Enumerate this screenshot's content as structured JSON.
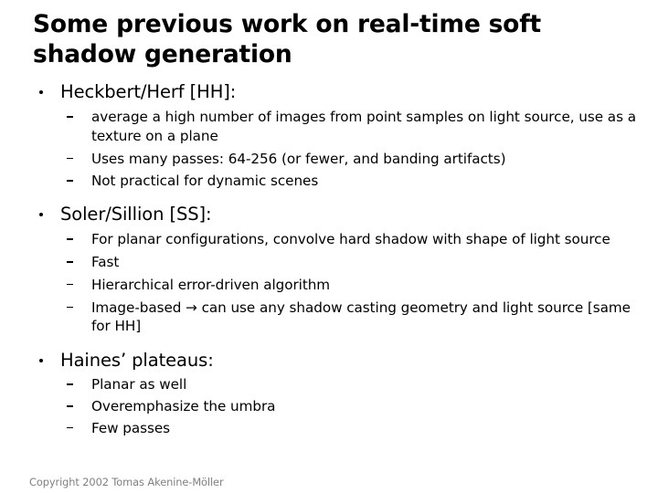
{
  "slide": {
    "title": "Some previous work on real-time soft shadow generation",
    "footer": "Copyright 2002 Tomas Akenine-Möller",
    "colors": {
      "background": "#ffffff",
      "text": "#000000",
      "footer_text": "#808080"
    },
    "groups": [
      {
        "heading": "Heckbert/Herf [HH]:",
        "items": [
          "average a high number of images from point samples on light source, use as a texture on a plane",
          "Uses many passes: 64-256 (or fewer, and banding artifacts)",
          "Not practical for dynamic scenes"
        ]
      },
      {
        "heading": "Soler/Sillion [SS]:",
        "items": [
          "For planar configurations, convolve hard shadow with shape of light source",
          "Fast",
          "Hierarchical error-driven algorithm",
          "Image-based → can use any shadow casting geometry and light source [same for HH]"
        ]
      },
      {
        "heading": "Haines’ plateaus:",
        "items": [
          "Planar as well",
          "Overemphasize the umbra",
          "Few passes"
        ]
      }
    ]
  }
}
